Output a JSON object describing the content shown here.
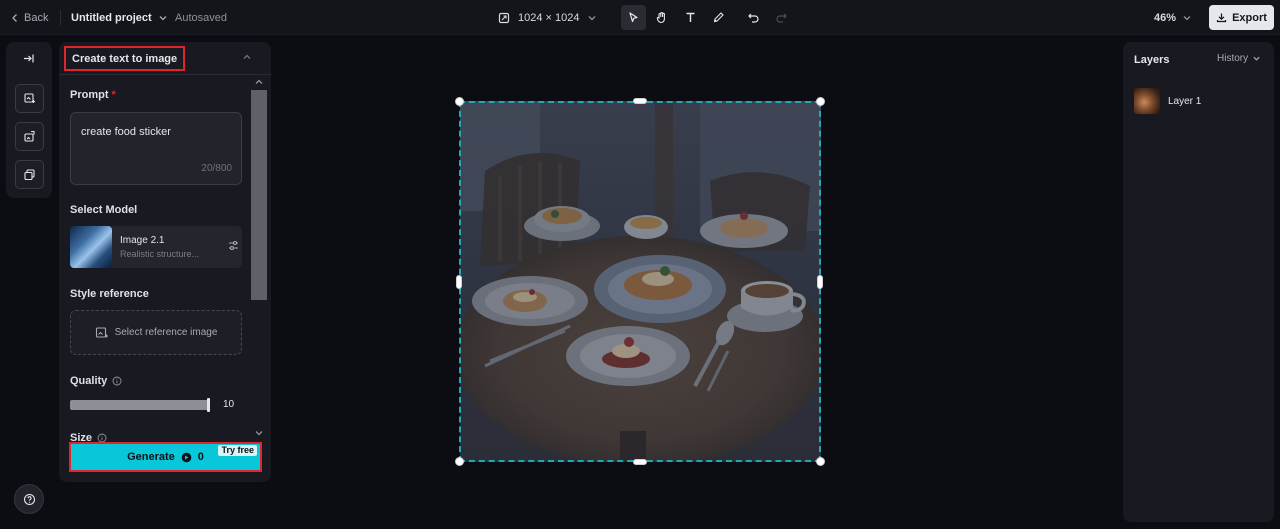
{
  "topbar": {
    "back_label": "Back",
    "project_name": "Untitled project",
    "save_status": "Autosaved",
    "canvas_size": "1024 × 1024",
    "zoom": "46%",
    "export_label": "Export",
    "tools": [
      "select-icon",
      "hand-icon",
      "text-icon",
      "pen-icon",
      "undo-icon",
      "redo-icon"
    ]
  },
  "left_toolbar": {
    "items": [
      "collapse-panel-icon",
      "text-to-image-icon",
      "image-to-image-icon",
      "layers-stack-icon"
    ],
    "help_icon": "help-icon"
  },
  "panel": {
    "title": "Create text to image",
    "prompt_label": "Prompt",
    "required_mark": "*",
    "prompt_value": "create food sticker",
    "prompt_count": "20/800",
    "model_label": "Select Model",
    "model_name": "Image 2.1",
    "model_desc": "Realistic structure...",
    "style_label": "Style reference",
    "style_button": "Select reference image",
    "quality_label": "Quality",
    "quality_value": "10",
    "quality_level": 1.0,
    "size_label": "Size",
    "generate_label": "Generate",
    "generate_cost": "0",
    "try_free": "Try free"
  },
  "right_panel": {
    "title": "Layers",
    "history_label": "History",
    "layers": [
      {
        "name": "Layer 1"
      }
    ]
  },
  "colors": {
    "accent": "#07c7d9",
    "highlight_border": "#e0262c",
    "selection": "#21a7b6",
    "background": "#0c0d12",
    "panel": "#191a21"
  }
}
